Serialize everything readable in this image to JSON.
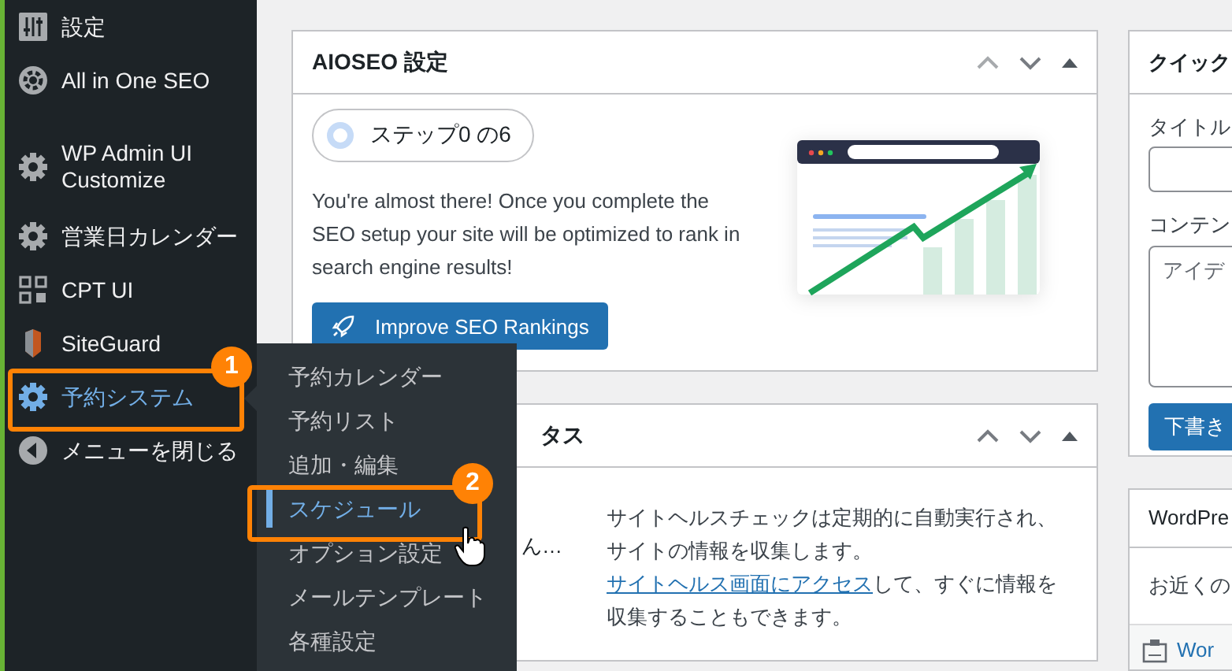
{
  "sidebar": {
    "items": [
      {
        "label": "設定",
        "kind": "sliders",
        "selected": false
      },
      {
        "label": "All in One SEO",
        "kind": "seo",
        "selected": false
      },
      {
        "label": "WP Admin UI Customize",
        "kind": "gear",
        "selected": false
      },
      {
        "label": "営業日カレンダー",
        "kind": "gear",
        "selected": false
      },
      {
        "label": "CPT UI",
        "kind": "grid",
        "selected": false
      },
      {
        "label": "SiteGuard",
        "kind": "shield",
        "selected": false
      },
      {
        "label": "予約システム",
        "kind": "gear",
        "selected": true
      },
      {
        "label": "メニューを閉じる",
        "kind": "collapse",
        "selected": false
      }
    ]
  },
  "flyout": {
    "items": [
      {
        "label": "予約カレンダー",
        "selected": false
      },
      {
        "label": "予約リスト",
        "selected": false
      },
      {
        "label": "追加・編集",
        "selected": false
      },
      {
        "label": "スケジュール",
        "selected": true
      },
      {
        "label": "オプション設定",
        "selected": false
      },
      {
        "label": "メールテンプレート",
        "selected": false
      },
      {
        "label": "各種設定",
        "selected": false
      }
    ]
  },
  "annotations": [
    {
      "label": "1"
    },
    {
      "label": "2"
    }
  ],
  "aioseo": {
    "title": "AIOSEO 設定",
    "step": "ステップ0 の6",
    "text": "You're almost there! Once you complete the SEO setup your site will be optimized to rank in search engine results!",
    "button": "Improve SEO Rankings"
  },
  "site_health": {
    "title": "タス",
    "status": "ん…",
    "text_before": "サイトヘルスチェックは定期的に自動実行され、サイトの情報を収集します。",
    "link": "サイトヘルス画面にアクセス",
    "text_after": "して、すぐに情報を収集することもできます。"
  },
  "quick_draft": {
    "title": "クイック",
    "title_label": "タイトル",
    "content_label": "コンテン",
    "content_placeholder": "アイデ",
    "button": "下書き"
  },
  "events": {
    "title": "WordPre",
    "text": "お近くの",
    "row": "Wor"
  }
}
